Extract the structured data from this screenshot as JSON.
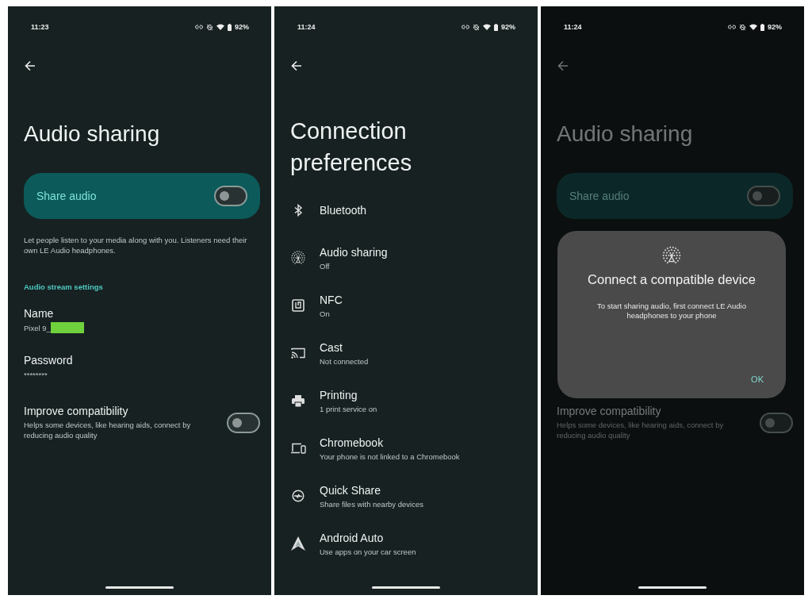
{
  "screens": [
    {
      "kind": "audio_sharing",
      "dimmed": false,
      "status_bar": {
        "time": "11:23",
        "battery": "92%"
      },
      "title": "Audio sharing",
      "main_switch": {
        "label": "Share audio",
        "on": false
      },
      "description": "Let people listen to your media along with you. Listeners need their own LE Audio headphones.",
      "section_header": "Audio stream settings",
      "fields": [
        {
          "label": "Name",
          "value": "Pixel 9_",
          "redacted": true
        },
        {
          "label": "Password",
          "value": "********",
          "redacted": false
        }
      ],
      "compat": {
        "title": "Improve compatibility",
        "summary": "Helps some devices, like hearing aids, connect by reducing audio quality",
        "on": false
      }
    },
    {
      "kind": "list",
      "dimmed": false,
      "status_bar": {
        "time": "11:24",
        "battery": "92%"
      },
      "title": "Connection preferences",
      "items": [
        {
          "title": "Bluetooth"
        },
        {
          "title": "Audio sharing",
          "summary": "Off"
        },
        {
          "title": "NFC",
          "summary": "On"
        },
        {
          "title": "Cast",
          "summary": "Not connected"
        },
        {
          "title": "Printing",
          "summary": "1 print service on"
        },
        {
          "title": "Chromebook",
          "summary": "Your phone is not linked to a Chromebook"
        },
        {
          "title": "Quick Share",
          "summary": "Share files with nearby devices"
        },
        {
          "title": "Android Auto",
          "summary": "Use apps on your car screen"
        }
      ]
    },
    {
      "kind": "audio_sharing",
      "dimmed": true,
      "status_bar": {
        "time": "11:24",
        "battery": "92%"
      },
      "title": "Audio sharing",
      "main_switch": {
        "label": "Share audio",
        "on": false
      },
      "compat": {
        "title": "Improve compatibility",
        "summary": "Helps some devices, like hearing aids, connect by reducing audio quality",
        "on": false
      },
      "dialog": {
        "title": "Connect a compatible device",
        "message": "To start sharing audio, first connect LE Audio headphones to your phone",
        "button": "OK"
      }
    }
  ]
}
